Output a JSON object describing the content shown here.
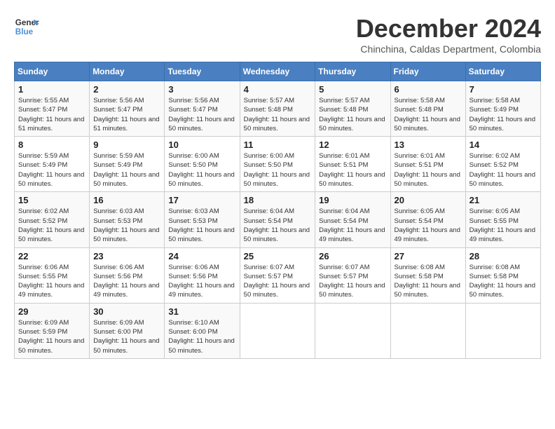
{
  "logo": {
    "line1": "General",
    "line2": "Blue"
  },
  "title": "December 2024",
  "location": "Chinchina, Caldas Department, Colombia",
  "days_of_week": [
    "Sunday",
    "Monday",
    "Tuesday",
    "Wednesday",
    "Thursday",
    "Friday",
    "Saturday"
  ],
  "weeks": [
    [
      {
        "day": "1",
        "sunrise": "5:55 AM",
        "sunset": "5:47 PM",
        "daylight": "11 hours and 51 minutes."
      },
      {
        "day": "2",
        "sunrise": "5:56 AM",
        "sunset": "5:47 PM",
        "daylight": "11 hours and 51 minutes."
      },
      {
        "day": "3",
        "sunrise": "5:56 AM",
        "sunset": "5:47 PM",
        "daylight": "11 hours and 50 minutes."
      },
      {
        "day": "4",
        "sunrise": "5:57 AM",
        "sunset": "5:48 PM",
        "daylight": "11 hours and 50 minutes."
      },
      {
        "day": "5",
        "sunrise": "5:57 AM",
        "sunset": "5:48 PM",
        "daylight": "11 hours and 50 minutes."
      },
      {
        "day": "6",
        "sunrise": "5:58 AM",
        "sunset": "5:48 PM",
        "daylight": "11 hours and 50 minutes."
      },
      {
        "day": "7",
        "sunrise": "5:58 AM",
        "sunset": "5:49 PM",
        "daylight": "11 hours and 50 minutes."
      }
    ],
    [
      {
        "day": "8",
        "sunrise": "5:59 AM",
        "sunset": "5:49 PM",
        "daylight": "11 hours and 50 minutes."
      },
      {
        "day": "9",
        "sunrise": "5:59 AM",
        "sunset": "5:49 PM",
        "daylight": "11 hours and 50 minutes."
      },
      {
        "day": "10",
        "sunrise": "6:00 AM",
        "sunset": "5:50 PM",
        "daylight": "11 hours and 50 minutes."
      },
      {
        "day": "11",
        "sunrise": "6:00 AM",
        "sunset": "5:50 PM",
        "daylight": "11 hours and 50 minutes."
      },
      {
        "day": "12",
        "sunrise": "6:01 AM",
        "sunset": "5:51 PM",
        "daylight": "11 hours and 50 minutes."
      },
      {
        "day": "13",
        "sunrise": "6:01 AM",
        "sunset": "5:51 PM",
        "daylight": "11 hours and 50 minutes."
      },
      {
        "day": "14",
        "sunrise": "6:02 AM",
        "sunset": "5:52 PM",
        "daylight": "11 hours and 50 minutes."
      }
    ],
    [
      {
        "day": "15",
        "sunrise": "6:02 AM",
        "sunset": "5:52 PM",
        "daylight": "11 hours and 50 minutes."
      },
      {
        "day": "16",
        "sunrise": "6:03 AM",
        "sunset": "5:53 PM",
        "daylight": "11 hours and 50 minutes."
      },
      {
        "day": "17",
        "sunrise": "6:03 AM",
        "sunset": "5:53 PM",
        "daylight": "11 hours and 50 minutes."
      },
      {
        "day": "18",
        "sunrise": "6:04 AM",
        "sunset": "5:54 PM",
        "daylight": "11 hours and 50 minutes."
      },
      {
        "day": "19",
        "sunrise": "6:04 AM",
        "sunset": "5:54 PM",
        "daylight": "11 hours and 49 minutes."
      },
      {
        "day": "20",
        "sunrise": "6:05 AM",
        "sunset": "5:54 PM",
        "daylight": "11 hours and 49 minutes."
      },
      {
        "day": "21",
        "sunrise": "6:05 AM",
        "sunset": "5:55 PM",
        "daylight": "11 hours and 49 minutes."
      }
    ],
    [
      {
        "day": "22",
        "sunrise": "6:06 AM",
        "sunset": "5:55 PM",
        "daylight": "11 hours and 49 minutes."
      },
      {
        "day": "23",
        "sunrise": "6:06 AM",
        "sunset": "5:56 PM",
        "daylight": "11 hours and 49 minutes."
      },
      {
        "day": "24",
        "sunrise": "6:06 AM",
        "sunset": "5:56 PM",
        "daylight": "11 hours and 49 minutes."
      },
      {
        "day": "25",
        "sunrise": "6:07 AM",
        "sunset": "5:57 PM",
        "daylight": "11 hours and 50 minutes."
      },
      {
        "day": "26",
        "sunrise": "6:07 AM",
        "sunset": "5:57 PM",
        "daylight": "11 hours and 50 minutes."
      },
      {
        "day": "27",
        "sunrise": "6:08 AM",
        "sunset": "5:58 PM",
        "daylight": "11 hours and 50 minutes."
      },
      {
        "day": "28",
        "sunrise": "6:08 AM",
        "sunset": "5:58 PM",
        "daylight": "11 hours and 50 minutes."
      }
    ],
    [
      {
        "day": "29",
        "sunrise": "6:09 AM",
        "sunset": "5:59 PM",
        "daylight": "11 hours and 50 minutes."
      },
      {
        "day": "30",
        "sunrise": "6:09 AM",
        "sunset": "6:00 PM",
        "daylight": "11 hours and 50 minutes."
      },
      {
        "day": "31",
        "sunrise": "6:10 AM",
        "sunset": "6:00 PM",
        "daylight": "11 hours and 50 minutes."
      },
      null,
      null,
      null,
      null
    ]
  ],
  "labels": {
    "sunrise": "Sunrise:",
    "sunset": "Sunset:",
    "daylight": "Daylight:"
  }
}
